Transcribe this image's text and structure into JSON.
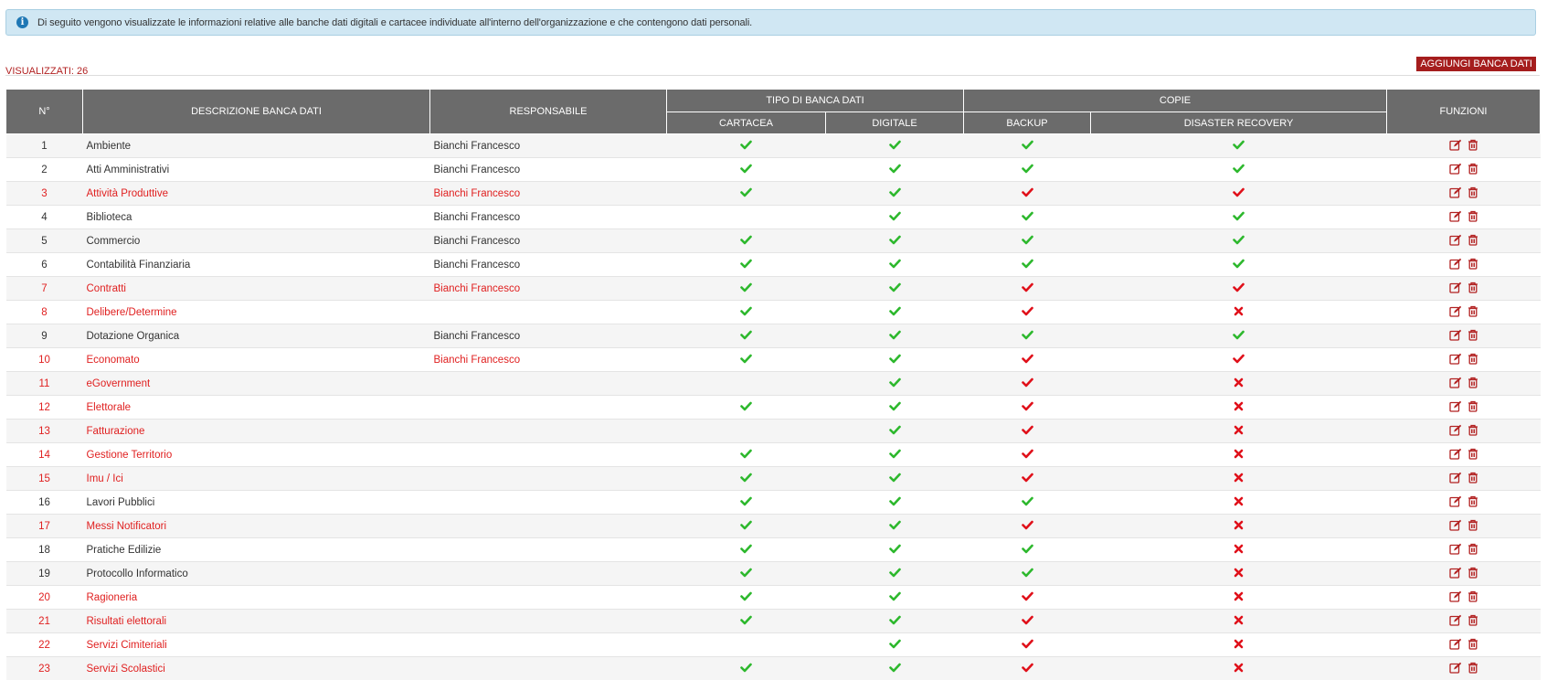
{
  "info": {
    "text": "Di seguito vengono visualizzate le informazioni relative alle banche dati digitali e cartacee individuate all'interno dell'organizzazione e che contengono dati personali."
  },
  "toolbar": {
    "count_label": "VISUALIZZATI: 26",
    "add_button": "AGGIUNGI BANCA DATI"
  },
  "table": {
    "headers": {
      "num": "N°",
      "desc": "DESCRIZIONE BANCA DATI",
      "resp": "RESPONSABILE",
      "tipo": "TIPO DI BANCA DATI",
      "copie": "COPIE",
      "funzioni": "FUNZIONI",
      "cartacea": "CARTACEA",
      "digitale": "DIGITALE",
      "backup": "BACKUP",
      "dr": "DISASTER RECOVERY"
    },
    "colors": {
      "ok": "#2db82d",
      "ko": "#e0101a",
      "header": "#6b6b6b",
      "action": "#b22222"
    },
    "rows": [
      {
        "n": "1",
        "desc": "Ambiente",
        "resp": "Bianchi Francesco",
        "red": false,
        "cart": "ok",
        "dig": "ok",
        "bk": "ok",
        "dr": "ok"
      },
      {
        "n": "2",
        "desc": "Atti Amministrativi",
        "resp": "Bianchi Francesco",
        "red": false,
        "cart": "ok",
        "dig": "ok",
        "bk": "ok",
        "dr": "ok"
      },
      {
        "n": "3",
        "desc": "Attività Produttive",
        "resp": "Bianchi Francesco",
        "red": true,
        "cart": "ok",
        "dig": "ok",
        "bk": "red",
        "dr": "red"
      },
      {
        "n": "4",
        "desc": "Biblioteca",
        "resp": "Bianchi Francesco",
        "red": false,
        "cart": "",
        "dig": "ok",
        "bk": "ok",
        "dr": "ok"
      },
      {
        "n": "5",
        "desc": "Commercio",
        "resp": "Bianchi Francesco",
        "red": false,
        "cart": "ok",
        "dig": "ok",
        "bk": "ok",
        "dr": "ok"
      },
      {
        "n": "6",
        "desc": "Contabilità Finanziaria",
        "resp": "Bianchi Francesco",
        "red": false,
        "cart": "ok",
        "dig": "ok",
        "bk": "ok",
        "dr": "ok"
      },
      {
        "n": "7",
        "desc": "Contratti",
        "resp": "Bianchi Francesco",
        "red": true,
        "cart": "ok",
        "dig": "ok",
        "bk": "red",
        "dr": "red"
      },
      {
        "n": "8",
        "desc": "Delibere/Determine",
        "resp": "",
        "red": true,
        "cart": "ok",
        "dig": "ok",
        "bk": "red",
        "dr": "x"
      },
      {
        "n": "9",
        "desc": "Dotazione Organica",
        "resp": "Bianchi Francesco",
        "red": false,
        "cart": "ok",
        "dig": "ok",
        "bk": "ok",
        "dr": "ok"
      },
      {
        "n": "10",
        "desc": "Economato",
        "resp": "Bianchi Francesco",
        "red": true,
        "cart": "ok",
        "dig": "ok",
        "bk": "red",
        "dr": "red"
      },
      {
        "n": "11",
        "desc": "eGovernment",
        "resp": "",
        "red": true,
        "cart": "",
        "dig": "ok",
        "bk": "red",
        "dr": "x"
      },
      {
        "n": "12",
        "desc": "Elettorale",
        "resp": "",
        "red": true,
        "cart": "ok",
        "dig": "ok",
        "bk": "red",
        "dr": "x"
      },
      {
        "n": "13",
        "desc": "Fatturazione",
        "resp": "",
        "red": true,
        "cart": "",
        "dig": "ok",
        "bk": "red",
        "dr": "x"
      },
      {
        "n": "14",
        "desc": "Gestione Territorio",
        "resp": "",
        "red": true,
        "cart": "ok",
        "dig": "ok",
        "bk": "red",
        "dr": "x"
      },
      {
        "n": "15",
        "desc": "Imu / Ici",
        "resp": "",
        "red": true,
        "cart": "ok",
        "dig": "ok",
        "bk": "red",
        "dr": "x"
      },
      {
        "n": "16",
        "desc": "Lavori Pubblici",
        "resp": "",
        "red": false,
        "cart": "ok",
        "dig": "ok",
        "bk": "ok",
        "dr": "x"
      },
      {
        "n": "17",
        "desc": "Messi Notificatori",
        "resp": "",
        "red": true,
        "cart": "ok",
        "dig": "ok",
        "bk": "red",
        "dr": "x"
      },
      {
        "n": "18",
        "desc": "Pratiche Edilizie",
        "resp": "",
        "red": false,
        "cart": "ok",
        "dig": "ok",
        "bk": "ok",
        "dr": "x"
      },
      {
        "n": "19",
        "desc": "Protocollo Informatico",
        "resp": "",
        "red": false,
        "cart": "ok",
        "dig": "ok",
        "bk": "ok",
        "dr": "x"
      },
      {
        "n": "20",
        "desc": "Ragioneria",
        "resp": "",
        "red": true,
        "cart": "ok",
        "dig": "ok",
        "bk": "red",
        "dr": "x"
      },
      {
        "n": "21",
        "desc": "Risultati elettorali",
        "resp": "",
        "red": true,
        "cart": "ok",
        "dig": "ok",
        "bk": "red",
        "dr": "x"
      },
      {
        "n": "22",
        "desc": "Servizi Cimiteriali",
        "resp": "",
        "red": true,
        "cart": "",
        "dig": "ok",
        "bk": "red",
        "dr": "x"
      },
      {
        "n": "23",
        "desc": "Servizi Scolastici",
        "resp": "",
        "red": true,
        "cart": "ok",
        "dig": "ok",
        "bk": "red",
        "dr": "x"
      }
    ],
    "actions": [
      "edit-icon",
      "trash-icon"
    ]
  }
}
